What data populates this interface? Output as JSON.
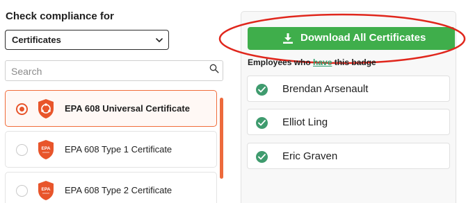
{
  "compliance": {
    "heading": "Check compliance for",
    "selected_type": "Certificates"
  },
  "search": {
    "placeholder": "Search"
  },
  "certificates": [
    {
      "name": "EPA 608 Universal Certificate",
      "selected": true,
      "badge_text": ""
    },
    {
      "name": "EPA 608 Type 1 Certificate",
      "selected": false,
      "badge_text": "EPA"
    },
    {
      "name": "EPA 608 Type 2 Certificate",
      "selected": false,
      "badge_text": "EPA"
    }
  ],
  "download": {
    "label": "Download All Certificates"
  },
  "employees_section": {
    "prefix": "Employees who ",
    "link": "have",
    "suffix": " this badge"
  },
  "employees": [
    {
      "name": "Brendan Arsenault"
    },
    {
      "name": "Elliot Ling"
    },
    {
      "name": "Eric Graven"
    }
  ],
  "colors": {
    "accent_orange": "#e8552b",
    "download_green": "#3fae4b",
    "check_green": "#3f9b6e",
    "highlight_red": "#e0261c"
  },
  "icons": {
    "select_chevron": "chevron-down-icon",
    "search": "search-icon",
    "download": "download-icon",
    "check": "check-circle-icon",
    "badge": "shield-badge-icon"
  }
}
